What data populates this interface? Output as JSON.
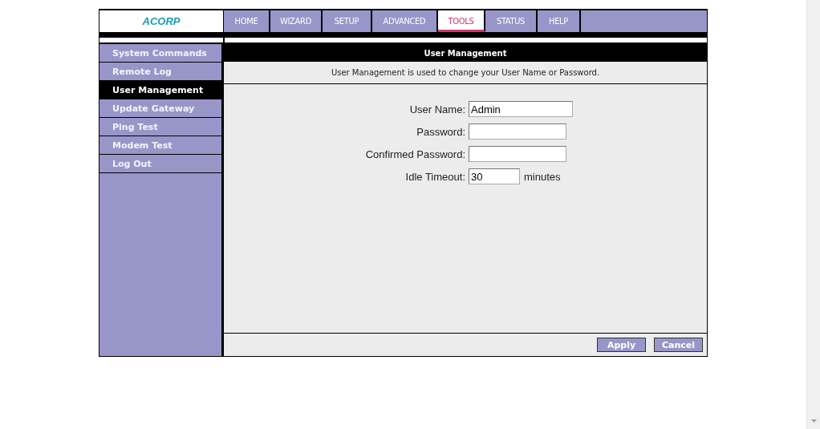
{
  "logo": "ACORP",
  "nav_tabs": [
    {
      "label": "HOME",
      "selected": false
    },
    {
      "label": "WIZARD",
      "selected": false
    },
    {
      "label": "SETUP",
      "selected": false
    },
    {
      "label": "ADVANCED",
      "selected": false
    },
    {
      "label": "TOOLS",
      "selected": true
    },
    {
      "label": "STATUS",
      "selected": false
    },
    {
      "label": "HELP",
      "selected": false
    }
  ],
  "sidebar": {
    "items": [
      {
        "label": "System Commands",
        "selected": false
      },
      {
        "label": "Remote Log",
        "selected": false
      },
      {
        "label": "User Management",
        "selected": true
      },
      {
        "label": "Update Gateway",
        "selected": false
      },
      {
        "label": "Ping Test",
        "selected": false
      },
      {
        "label": "Modem Test",
        "selected": false
      },
      {
        "label": "Log Out",
        "selected": false
      }
    ]
  },
  "panel": {
    "title": "User Management",
    "description": "User Management is used to change your User Name or Password.",
    "fields": [
      {
        "label": "User Name:",
        "value": "Admin",
        "kind": "text"
      },
      {
        "label": "Password:",
        "kind": "password"
      },
      {
        "label": "Confirmed Password:",
        "kind": "password"
      },
      {
        "label": "Idle Timeout:",
        "value": "30",
        "kind": "text",
        "unit": "minutes"
      }
    ],
    "buttons": [
      "Apply",
      "Cancel"
    ]
  }
}
